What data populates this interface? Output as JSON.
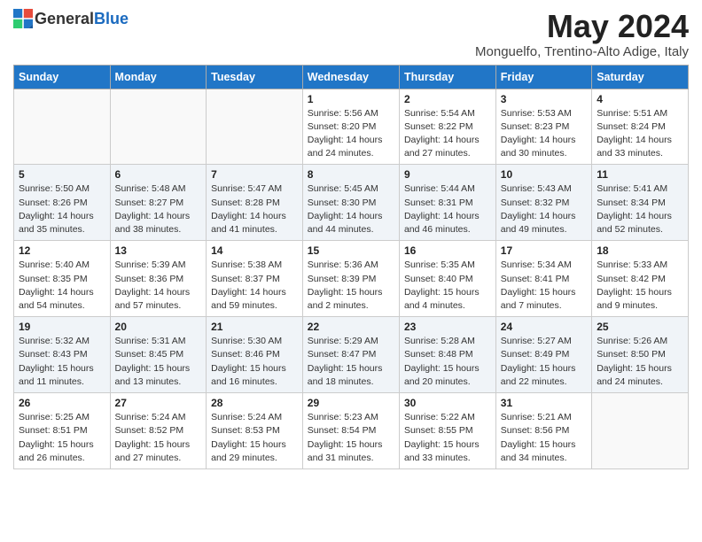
{
  "header": {
    "logo_general": "General",
    "logo_blue": "Blue",
    "title": "May 2024",
    "subtitle": "Monguelfo, Trentino-Alto Adige, Italy"
  },
  "days_of_week": [
    "Sunday",
    "Monday",
    "Tuesday",
    "Wednesday",
    "Thursday",
    "Friday",
    "Saturday"
  ],
  "weeks": [
    [
      {
        "day": "",
        "info": ""
      },
      {
        "day": "",
        "info": ""
      },
      {
        "day": "",
        "info": ""
      },
      {
        "day": "1",
        "info": "Sunrise: 5:56 AM\nSunset: 8:20 PM\nDaylight: 14 hours and 24 minutes."
      },
      {
        "day": "2",
        "info": "Sunrise: 5:54 AM\nSunset: 8:22 PM\nDaylight: 14 hours and 27 minutes."
      },
      {
        "day": "3",
        "info": "Sunrise: 5:53 AM\nSunset: 8:23 PM\nDaylight: 14 hours and 30 minutes."
      },
      {
        "day": "4",
        "info": "Sunrise: 5:51 AM\nSunset: 8:24 PM\nDaylight: 14 hours and 33 minutes."
      }
    ],
    [
      {
        "day": "5",
        "info": "Sunrise: 5:50 AM\nSunset: 8:26 PM\nDaylight: 14 hours and 35 minutes."
      },
      {
        "day": "6",
        "info": "Sunrise: 5:48 AM\nSunset: 8:27 PM\nDaylight: 14 hours and 38 minutes."
      },
      {
        "day": "7",
        "info": "Sunrise: 5:47 AM\nSunset: 8:28 PM\nDaylight: 14 hours and 41 minutes."
      },
      {
        "day": "8",
        "info": "Sunrise: 5:45 AM\nSunset: 8:30 PM\nDaylight: 14 hours and 44 minutes."
      },
      {
        "day": "9",
        "info": "Sunrise: 5:44 AM\nSunset: 8:31 PM\nDaylight: 14 hours and 46 minutes."
      },
      {
        "day": "10",
        "info": "Sunrise: 5:43 AM\nSunset: 8:32 PM\nDaylight: 14 hours and 49 minutes."
      },
      {
        "day": "11",
        "info": "Sunrise: 5:41 AM\nSunset: 8:34 PM\nDaylight: 14 hours and 52 minutes."
      }
    ],
    [
      {
        "day": "12",
        "info": "Sunrise: 5:40 AM\nSunset: 8:35 PM\nDaylight: 14 hours and 54 minutes."
      },
      {
        "day": "13",
        "info": "Sunrise: 5:39 AM\nSunset: 8:36 PM\nDaylight: 14 hours and 57 minutes."
      },
      {
        "day": "14",
        "info": "Sunrise: 5:38 AM\nSunset: 8:37 PM\nDaylight: 14 hours and 59 minutes."
      },
      {
        "day": "15",
        "info": "Sunrise: 5:36 AM\nSunset: 8:39 PM\nDaylight: 15 hours and 2 minutes."
      },
      {
        "day": "16",
        "info": "Sunrise: 5:35 AM\nSunset: 8:40 PM\nDaylight: 15 hours and 4 minutes."
      },
      {
        "day": "17",
        "info": "Sunrise: 5:34 AM\nSunset: 8:41 PM\nDaylight: 15 hours and 7 minutes."
      },
      {
        "day": "18",
        "info": "Sunrise: 5:33 AM\nSunset: 8:42 PM\nDaylight: 15 hours and 9 minutes."
      }
    ],
    [
      {
        "day": "19",
        "info": "Sunrise: 5:32 AM\nSunset: 8:43 PM\nDaylight: 15 hours and 11 minutes."
      },
      {
        "day": "20",
        "info": "Sunrise: 5:31 AM\nSunset: 8:45 PM\nDaylight: 15 hours and 13 minutes."
      },
      {
        "day": "21",
        "info": "Sunrise: 5:30 AM\nSunset: 8:46 PM\nDaylight: 15 hours and 16 minutes."
      },
      {
        "day": "22",
        "info": "Sunrise: 5:29 AM\nSunset: 8:47 PM\nDaylight: 15 hours and 18 minutes."
      },
      {
        "day": "23",
        "info": "Sunrise: 5:28 AM\nSunset: 8:48 PM\nDaylight: 15 hours and 20 minutes."
      },
      {
        "day": "24",
        "info": "Sunrise: 5:27 AM\nSunset: 8:49 PM\nDaylight: 15 hours and 22 minutes."
      },
      {
        "day": "25",
        "info": "Sunrise: 5:26 AM\nSunset: 8:50 PM\nDaylight: 15 hours and 24 minutes."
      }
    ],
    [
      {
        "day": "26",
        "info": "Sunrise: 5:25 AM\nSunset: 8:51 PM\nDaylight: 15 hours and 26 minutes."
      },
      {
        "day": "27",
        "info": "Sunrise: 5:24 AM\nSunset: 8:52 PM\nDaylight: 15 hours and 27 minutes."
      },
      {
        "day": "28",
        "info": "Sunrise: 5:24 AM\nSunset: 8:53 PM\nDaylight: 15 hours and 29 minutes."
      },
      {
        "day": "29",
        "info": "Sunrise: 5:23 AM\nSunset: 8:54 PM\nDaylight: 15 hours and 31 minutes."
      },
      {
        "day": "30",
        "info": "Sunrise: 5:22 AM\nSunset: 8:55 PM\nDaylight: 15 hours and 33 minutes."
      },
      {
        "day": "31",
        "info": "Sunrise: 5:21 AM\nSunset: 8:56 PM\nDaylight: 15 hours and 34 minutes."
      },
      {
        "day": "",
        "info": ""
      }
    ]
  ]
}
